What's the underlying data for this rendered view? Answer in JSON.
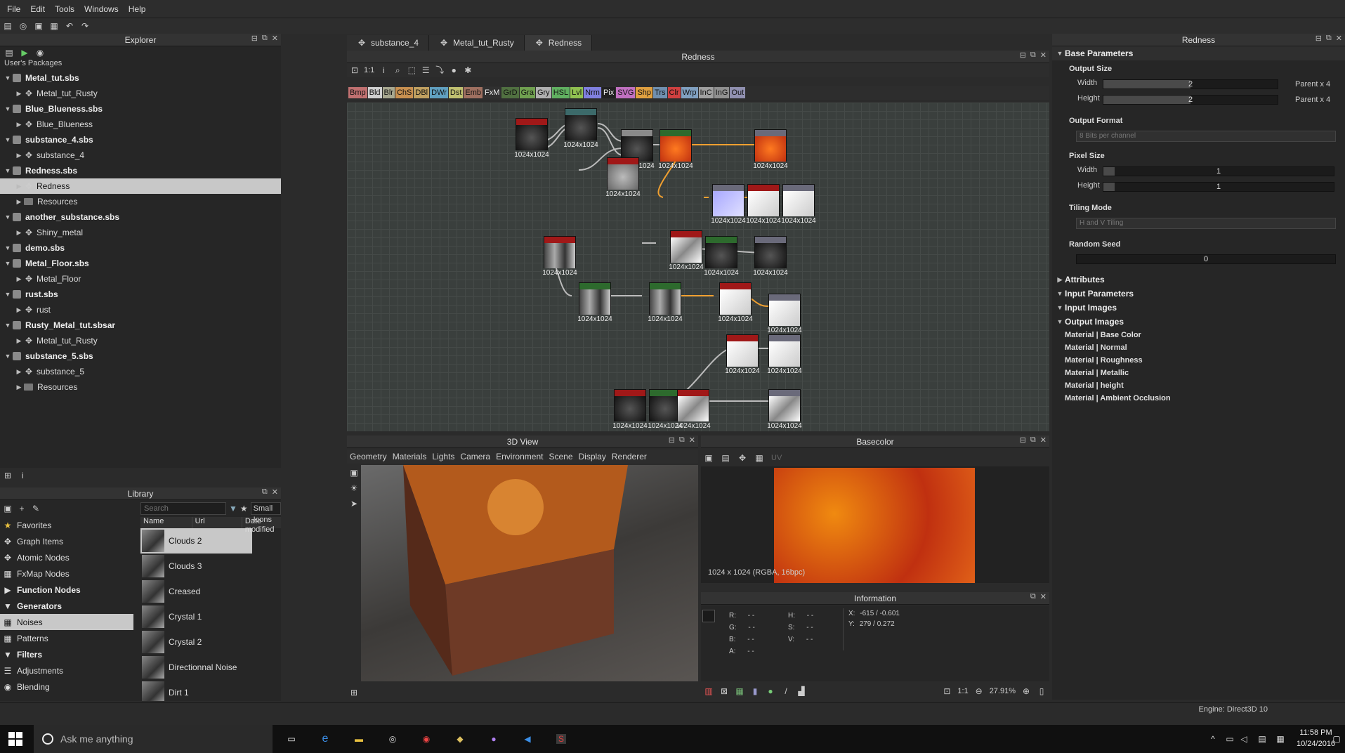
{
  "menu": [
    "File",
    "Edit",
    "Tools",
    "Windows",
    "Help"
  ],
  "explorer": {
    "title": "Explorer",
    "section_label": "User's Packages",
    "packages": [
      {
        "name": "Metal_tut.sbs",
        "children": [
          {
            "label": "Metal_tut_Rusty",
            "type": "graph"
          }
        ]
      },
      {
        "name": "Blue_Blueness.sbs",
        "children": [
          {
            "label": "Blue_Blueness",
            "type": "graph"
          }
        ]
      },
      {
        "name": "substance_4.sbs",
        "children": [
          {
            "label": "substance_4",
            "type": "graph"
          }
        ]
      },
      {
        "name": "Redness.sbs",
        "children": [
          {
            "label": "Redness",
            "type": "graph",
            "selected": true
          },
          {
            "label": "Resources",
            "type": "folder"
          }
        ]
      },
      {
        "name": "another_substance.sbs",
        "children": [
          {
            "label": "Shiny_metal",
            "type": "graph"
          }
        ]
      },
      {
        "name": "demo.sbs",
        "children": []
      },
      {
        "name": "Metal_Floor.sbs",
        "children": [
          {
            "label": "Metal_Floor",
            "type": "graph"
          }
        ]
      },
      {
        "name": "rust.sbs",
        "children": [
          {
            "label": "rust",
            "type": "graph"
          }
        ]
      },
      {
        "name": "Rusty_Metal_tut.sbsar",
        "children": [
          {
            "label": "Metal_tut_Rusty",
            "type": "graph"
          }
        ]
      },
      {
        "name": "substance_5.sbs",
        "children": [
          {
            "label": "substance_5",
            "type": "graph"
          },
          {
            "label": "Resources",
            "type": "folder"
          }
        ]
      }
    ]
  },
  "graph": {
    "tabs": [
      {
        "label": "substance_4",
        "active": false
      },
      {
        "label": "Metal_tut_Rusty",
        "active": false
      },
      {
        "label": "Redness",
        "active": true
      }
    ],
    "title": "Redness",
    "zoom_label": "1:1",
    "filters": [
      {
        "t": "Bmp",
        "c": "#c07070"
      },
      {
        "t": "Bld",
        "c": "#d0d0d0"
      },
      {
        "t": "Blr",
        "c": "#a8a890"
      },
      {
        "t": "ChS",
        "c": "#c89050"
      },
      {
        "t": "DBl",
        "c": "#c0a060"
      },
      {
        "t": "DWr",
        "c": "#60a0c0"
      },
      {
        "t": "Dst",
        "c": "#c0c070"
      },
      {
        "t": "Emb",
        "c": "#a07060"
      },
      {
        "t": "FxM",
        "c": "#303030"
      },
      {
        "t": "GrD",
        "c": "#507040"
      },
      {
        "t": "Gra",
        "c": "#70a050"
      },
      {
        "t": "Gry",
        "c": "#b0b0b0"
      },
      {
        "t": "HSL",
        "c": "#60b060"
      },
      {
        "t": "Lvl",
        "c": "#90c050"
      },
      {
        "t": "Nrm",
        "c": "#8080e0"
      },
      {
        "t": "Pix",
        "c": "#202020"
      },
      {
        "t": "SVG",
        "c": "#c070c0"
      },
      {
        "t": "Shp",
        "c": "#e0a040"
      },
      {
        "t": "Trs",
        "c": "#7090b0"
      },
      {
        "t": "Clr",
        "c": "#d04040"
      },
      {
        "t": "Wrp",
        "c": "#80a0c0"
      },
      {
        "t": "InC",
        "c": "#a0a0a0"
      },
      {
        "t": "InG",
        "c": "#909090"
      },
      {
        "t": "Out",
        "c": "#9090b0"
      }
    ],
    "node_label": "1024x1024"
  },
  "view3d": {
    "title": "3D View",
    "menu": [
      "Geometry",
      "Materials",
      "Lights",
      "Camera",
      "Environment",
      "Scene",
      "Display",
      "Renderer"
    ]
  },
  "basecolor": {
    "title": "Basecolor",
    "res_label": "1024 x 1024 (RGBA, 16bpc)",
    "zoom": "27.91%",
    "ratio": "1:1",
    "uv": "UV"
  },
  "info": {
    "title": "Information",
    "r": "R:",
    "g": "G:",
    "b": "B:",
    "a": "A:",
    "h": "H:",
    "s": "S:",
    "v": "V:",
    "dash": "- -",
    "x_lbl": "X:",
    "x_val": "-615 / -0.601",
    "y_lbl": "Y:",
    "y_val": "279 / 0.272"
  },
  "library": {
    "title": "Library",
    "search_placeholder": "Search",
    "view_mode": "Small Icons",
    "columns": [
      "Name",
      "Url",
      "Date modified"
    ],
    "categories": [
      {
        "label": "Favorites",
        "bold": false,
        "icon": "star"
      },
      {
        "label": "Graph Items",
        "bold": false,
        "icon": "graph"
      },
      {
        "label": "Atomic Nodes",
        "bold": false,
        "icon": "atomic"
      },
      {
        "label": "FxMap Nodes",
        "bold": false,
        "icon": "fxmap"
      },
      {
        "label": "Function Nodes",
        "bold": true,
        "icon": "tri"
      },
      {
        "label": "Generators",
        "bold": true,
        "icon": "tri-open"
      },
      {
        "label": "Noises",
        "bold": false,
        "icon": "noise",
        "selected": true
      },
      {
        "label": "Patterns",
        "bold": false,
        "icon": "pattern"
      },
      {
        "label": "Filters",
        "bold": true,
        "icon": "tri-open"
      },
      {
        "label": "Adjustments",
        "bold": false,
        "icon": "adjust"
      },
      {
        "label": "Blending",
        "bold": false,
        "icon": "blend"
      }
    ],
    "items": [
      "Clouds 2",
      "Clouds 3",
      "Creased",
      "Crystal 1",
      "Crystal 2",
      "Directionnal Noise",
      "Dirt 1"
    ]
  },
  "props": {
    "title": "Redness",
    "base_params": "Base Parameters",
    "output_size": "Output Size",
    "width_lbl": "Width",
    "height_lbl": "Height",
    "width_val": "2",
    "height_val": "2",
    "parent_w": "Parent x 4",
    "parent_h": "Parent x 4",
    "output_format": "Output Format",
    "output_format_val": "8 Bits per channel",
    "pixel_size": "Pixel Size",
    "px_w": "1",
    "px_h": "1",
    "tiling_mode": "Tiling Mode",
    "tiling_val": "H and V Tiling",
    "random_seed": "Random Seed",
    "seed_val": "0",
    "attributes": "Attributes",
    "input_params": "Input Parameters",
    "input_images": "Input Images",
    "output_images": "Output Images",
    "outputs": [
      "Material | Base Color",
      "Material | Normal",
      "Material | Roughness",
      "Material | Metallic",
      "Material | height",
      "Material | Ambient Occlusion"
    ]
  },
  "status": {
    "engine": "Engine: Direct3D 10"
  },
  "taskbar": {
    "search": "Ask me anything",
    "time": "11:58 PM",
    "date": "10/24/2016"
  }
}
